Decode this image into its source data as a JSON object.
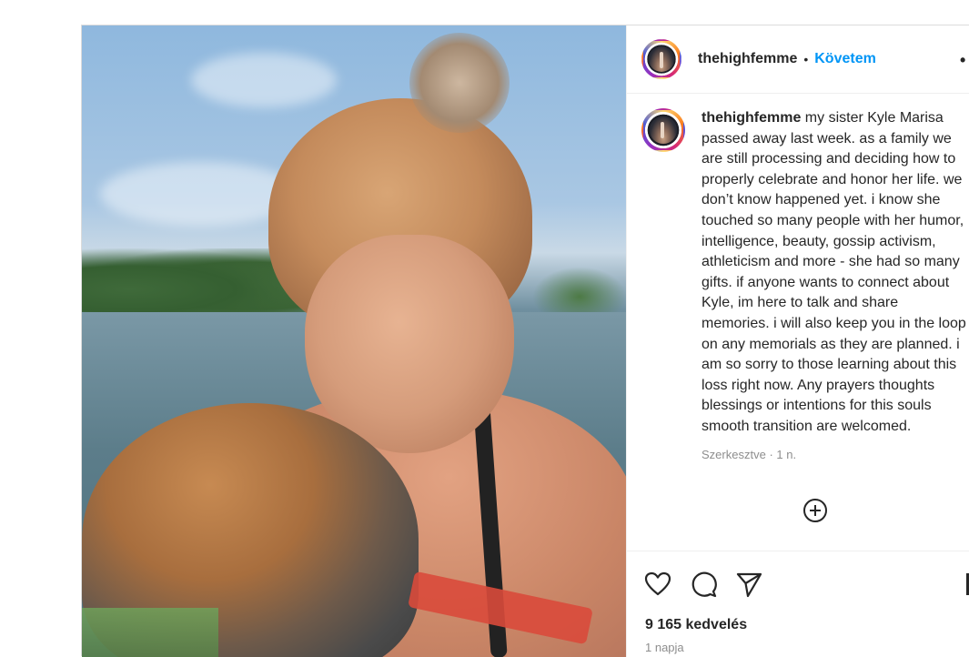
{
  "post": {
    "header": {
      "username": "thehighfemme",
      "separator": "•",
      "follow_label": "Követem",
      "more_label": "•"
    },
    "caption": {
      "username": "thehighfemme",
      "text": "my sister Kyle Marisa passed away last week. as a family we are still processing and deciding how to properly celebrate and honor her life. we don’t know happened yet. i know she touched so many people with her humor, intelligence, beauty, gossip activism, athleticism and more - she had so many gifts. if anyone wants to connect about Kyle, im here to talk and share memories. i will also keep you in the loop on any memorials as they are planned. i am so sorry to those learning about this loss right now. Any prayers thoughts blessings or intentions for this souls smooth transition are welcomed.",
      "edited_label": "Szerkesztve",
      "meta_separator": "·",
      "age": "1 n."
    },
    "likes": "9 165 kedvelés",
    "date": "1 napja",
    "icons": {
      "add_comment": "plus-circle-icon",
      "like": "heart-icon",
      "comment": "comment-icon",
      "share": "send-icon",
      "save": "bookmark-icon"
    },
    "colors": {
      "follow_blue": "#0095f6",
      "text": "#262626",
      "secondary": "#8e8e8e",
      "border": "#dbdbdb"
    }
  }
}
